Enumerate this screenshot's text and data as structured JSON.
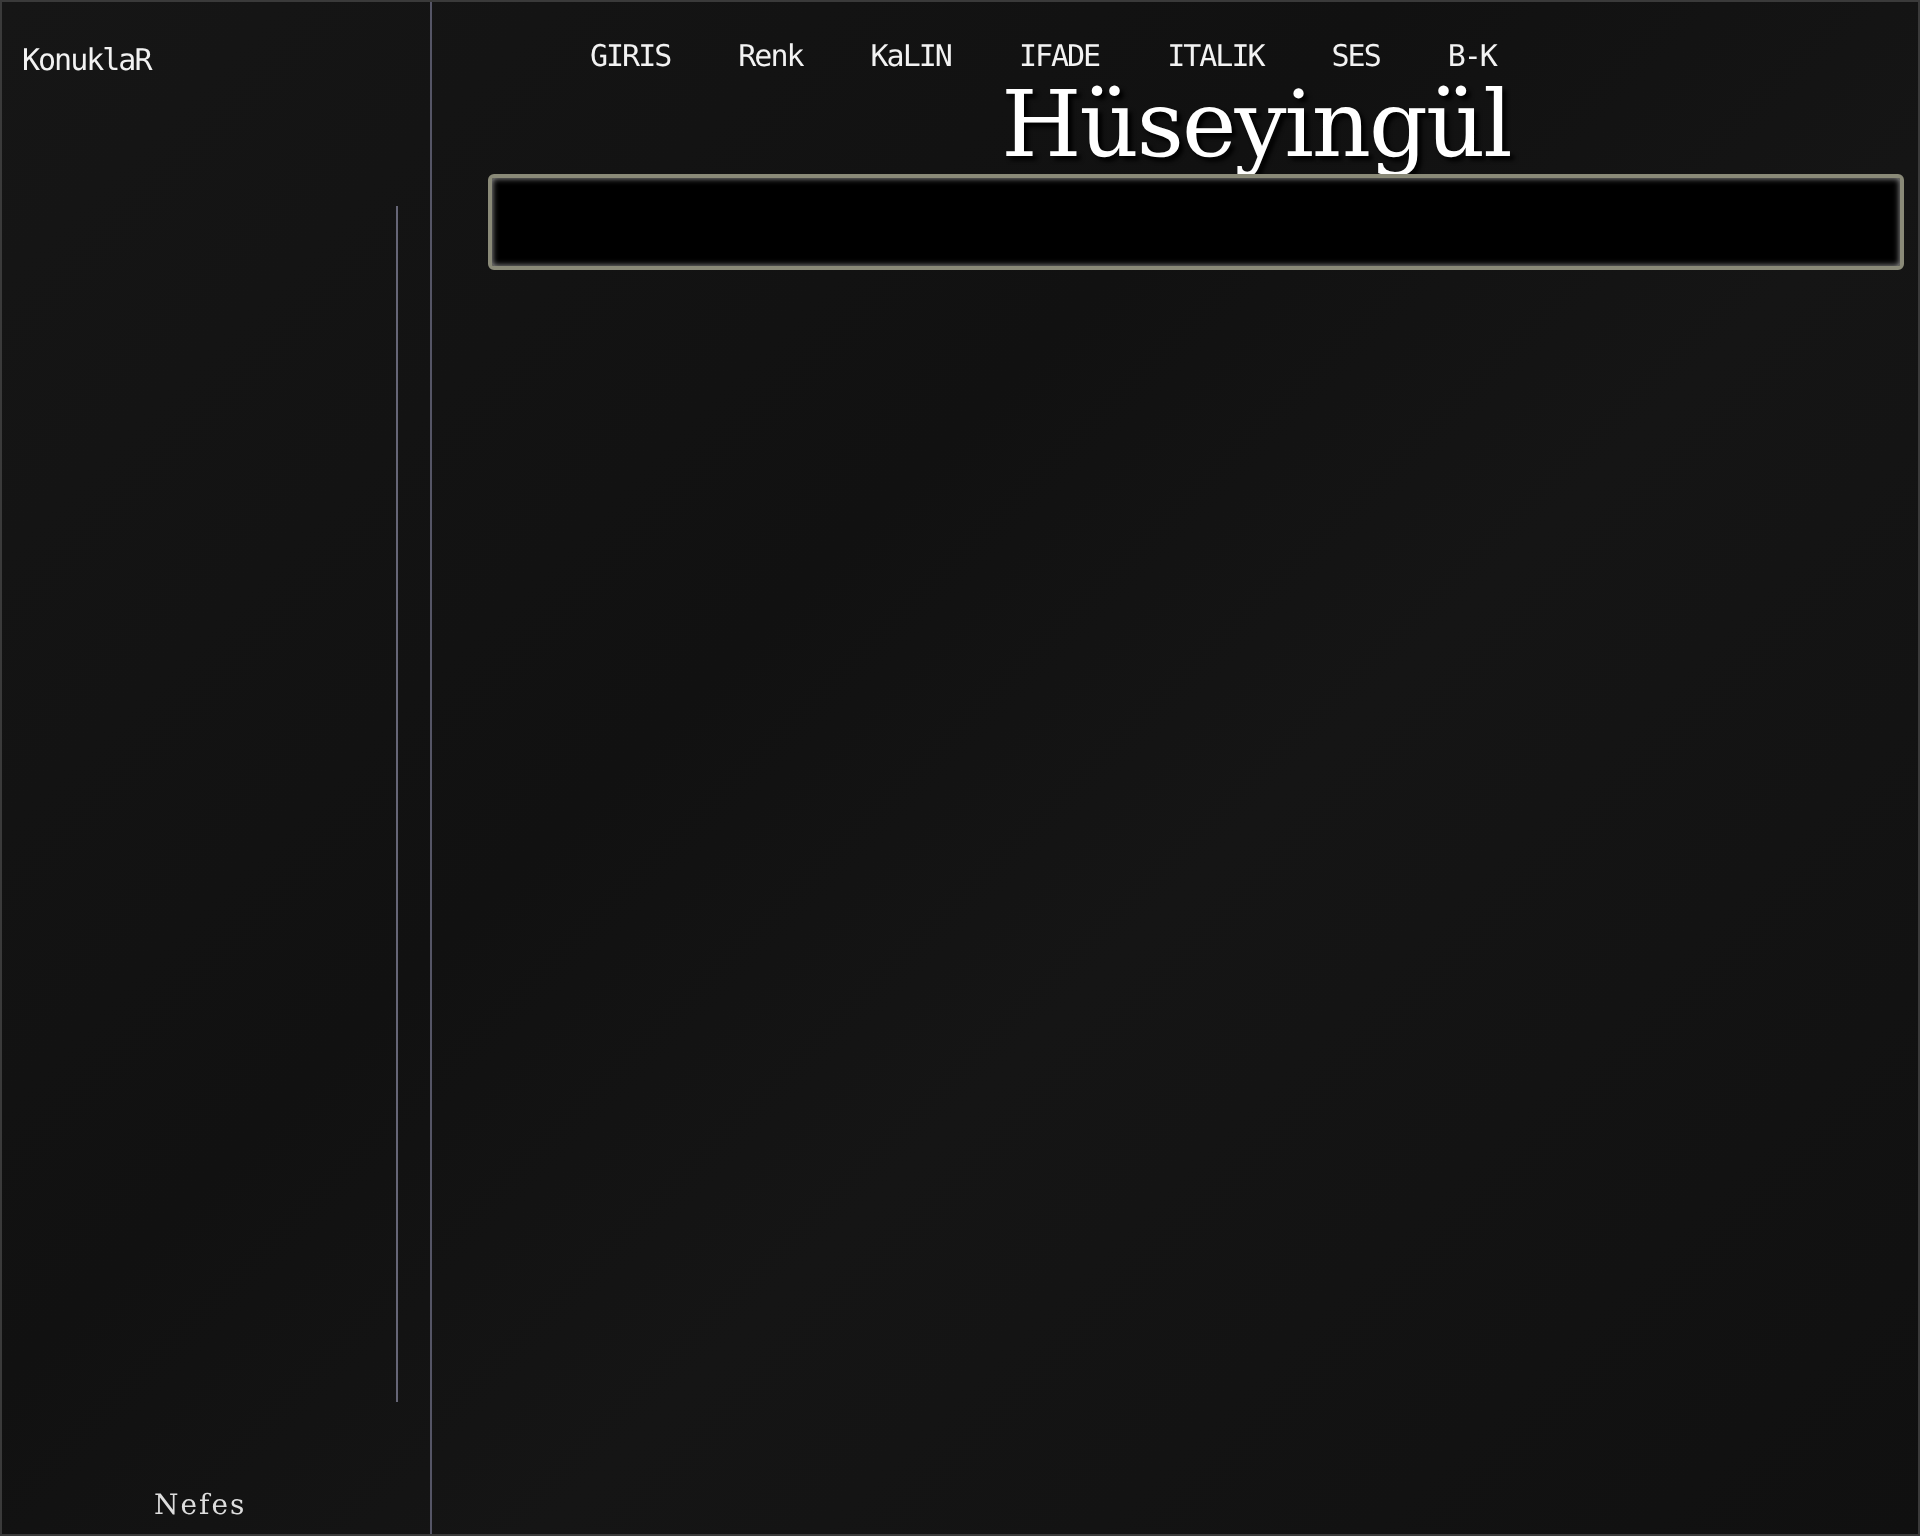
{
  "sidebar": {
    "title": "KonuklaR",
    "footer": "Nefes"
  },
  "nav": [
    {
      "label": "GIRIS"
    },
    {
      "label": "Renk"
    },
    {
      "label": "KaLIN"
    },
    {
      "label": "IFADE"
    },
    {
      "label": "ITALIK"
    },
    {
      "label": "SES"
    },
    {
      "label": "B-K"
    }
  ],
  "header": {
    "title": "Hüseyingül"
  }
}
